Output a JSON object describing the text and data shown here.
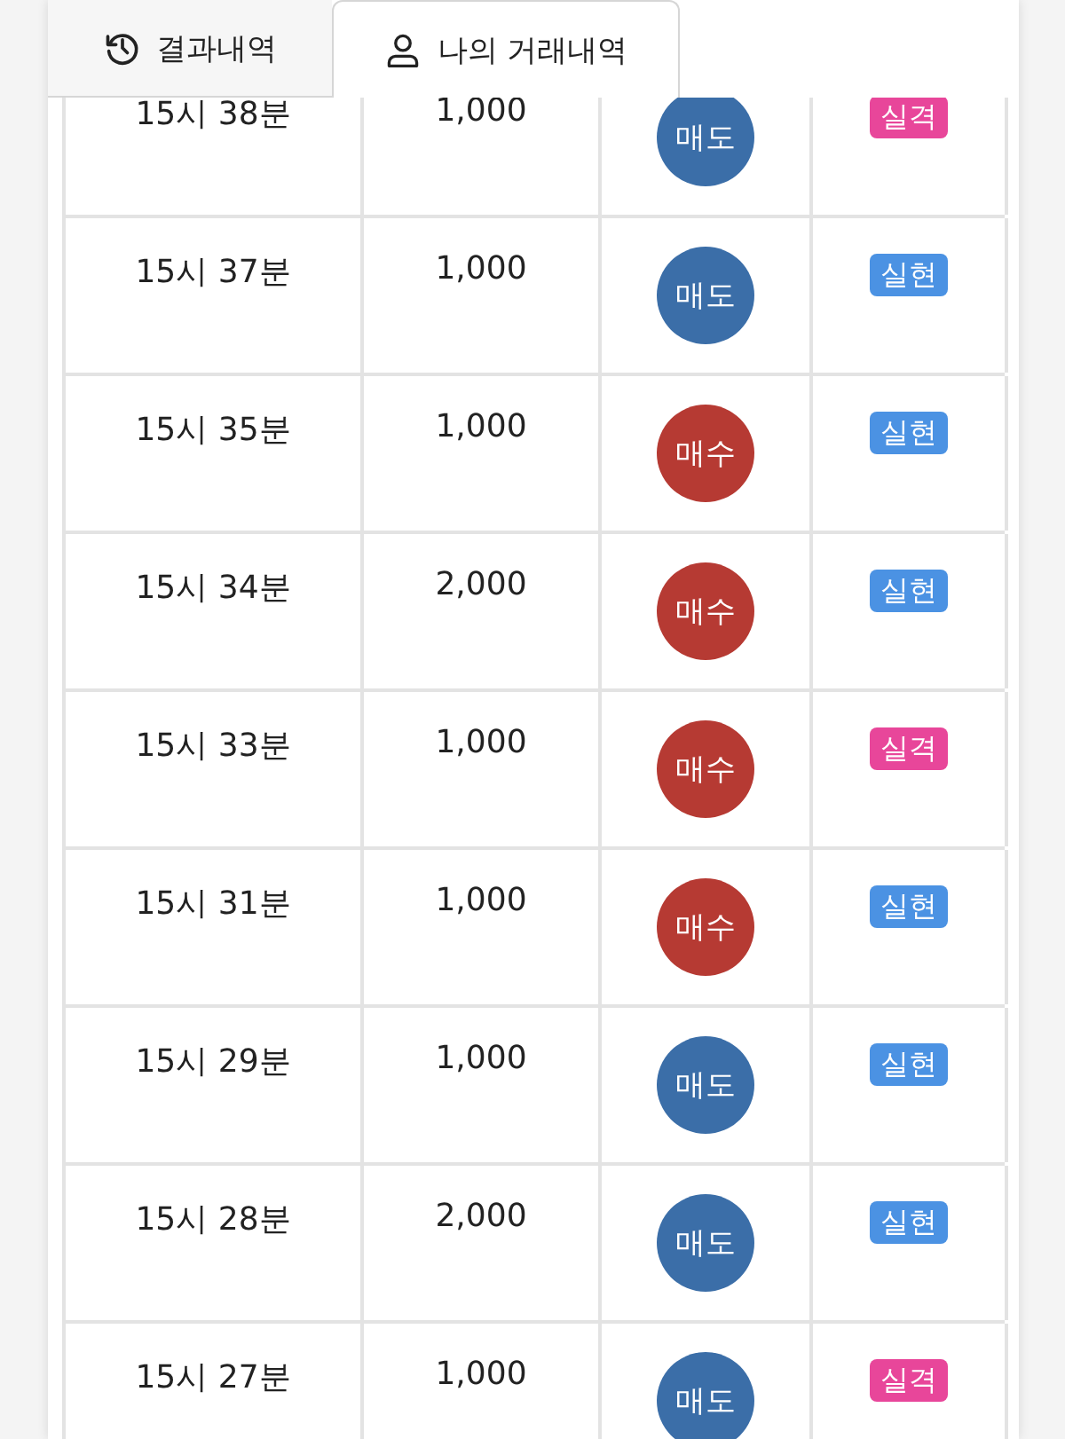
{
  "tabs": [
    {
      "label": "결과내역",
      "selected": false
    },
    {
      "label": "나의 거래내역",
      "selected": true
    }
  ],
  "rows": [
    {
      "time": "15시 38분",
      "amount": "1,000",
      "side": {
        "label": "매도",
        "kind": "sell"
      },
      "result": {
        "label": "실격",
        "kind": "fail"
      }
    },
    {
      "time": "15시 37분",
      "amount": "1,000",
      "side": {
        "label": "매도",
        "kind": "sell"
      },
      "result": {
        "label": "실현",
        "kind": "win"
      }
    },
    {
      "time": "15시 35분",
      "amount": "1,000",
      "side": {
        "label": "매수",
        "kind": "buy"
      },
      "result": {
        "label": "실현",
        "kind": "win"
      }
    },
    {
      "time": "15시 34분",
      "amount": "2,000",
      "side": {
        "label": "매수",
        "kind": "buy"
      },
      "result": {
        "label": "실현",
        "kind": "win"
      }
    },
    {
      "time": "15시 33분",
      "amount": "1,000",
      "side": {
        "label": "매수",
        "kind": "buy"
      },
      "result": {
        "label": "실격",
        "kind": "fail"
      }
    },
    {
      "time": "15시 31분",
      "amount": "1,000",
      "side": {
        "label": "매수",
        "kind": "buy"
      },
      "result": {
        "label": "실현",
        "kind": "win"
      }
    },
    {
      "time": "15시 29분",
      "amount": "1,000",
      "side": {
        "label": "매도",
        "kind": "sell"
      },
      "result": {
        "label": "실현",
        "kind": "win"
      }
    },
    {
      "time": "15시 28분",
      "amount": "2,000",
      "side": {
        "label": "매도",
        "kind": "sell"
      },
      "result": {
        "label": "실현",
        "kind": "win"
      }
    },
    {
      "time": "15시 27분",
      "amount": "1,000",
      "side": {
        "label": "매도",
        "kind": "sell"
      },
      "result": {
        "label": "실격",
        "kind": "fail"
      }
    }
  ]
}
